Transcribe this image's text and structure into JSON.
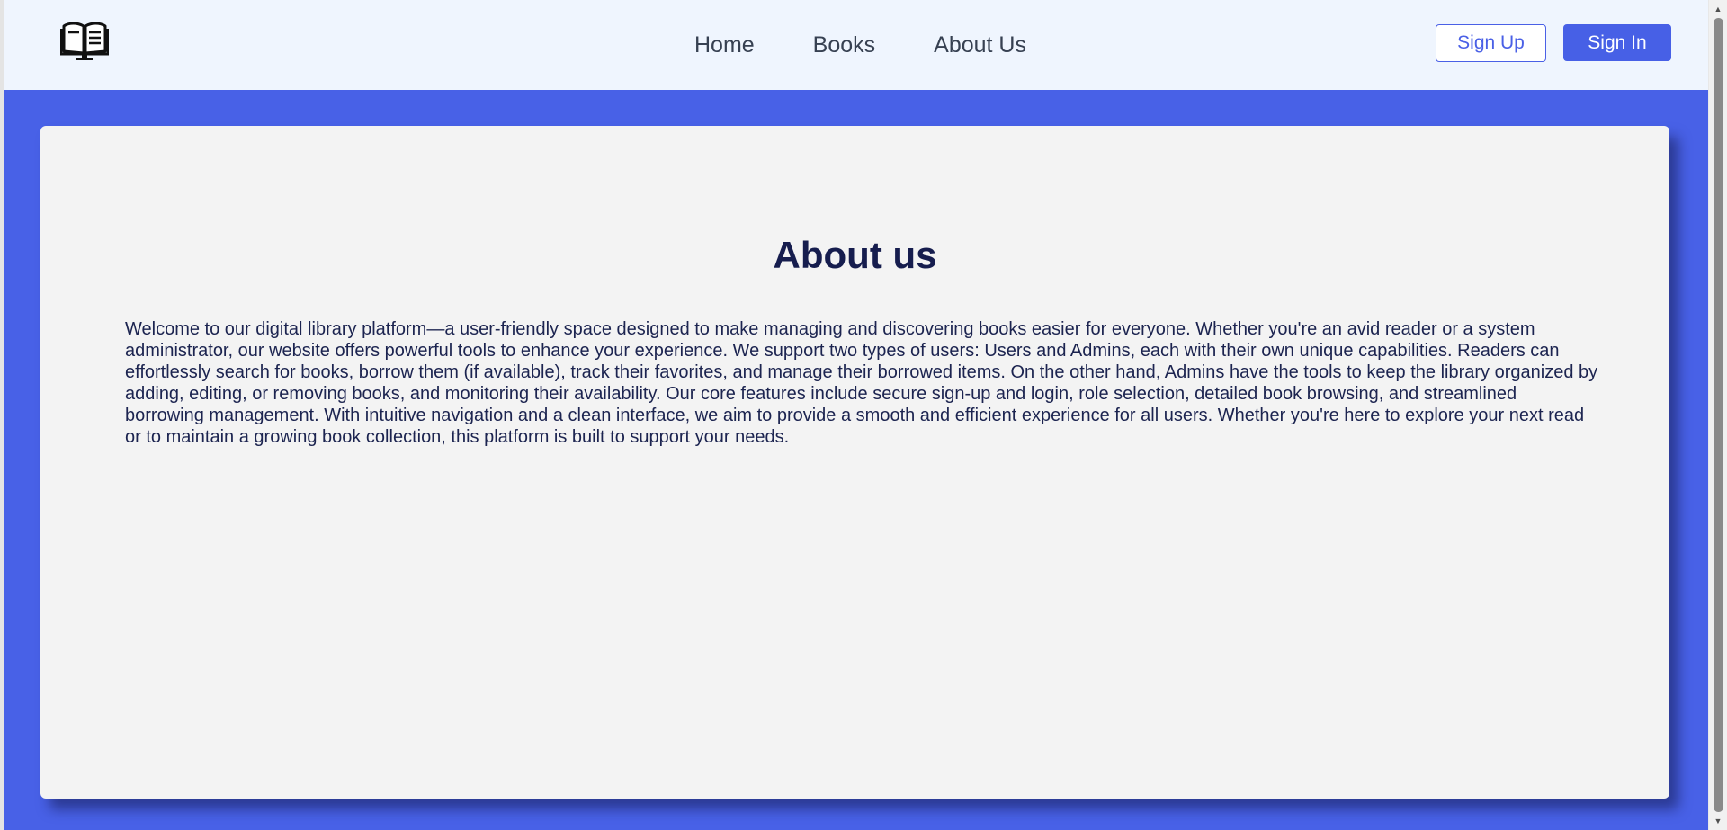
{
  "navbar": {
    "logo_icon": "open-book-monitor-icon",
    "links": [
      {
        "label": "Home"
      },
      {
        "label": "Books"
      },
      {
        "label": "About Us"
      }
    ],
    "signup_label": "Sign Up",
    "signin_label": "Sign In"
  },
  "about": {
    "title": "About us",
    "body": "Welcome to our digital library platform—a user-friendly space designed to make managing and discovering books easier for everyone. Whether you're an avid reader or a system administrator, our website offers powerful tools to enhance your experience. We support two types of users: Users and Admins, each with their own unique capabilities. Readers can effortlessly search for books, borrow them (if available), track their favorites, and manage their borrowed items. On the other hand, Admins have the tools to keep the library organized by adding, editing, or removing books, and monitoring their availability. Our core features include secure sign-up and login, role selection, detailed book browsing, and streamlined borrowing management. With intuitive navigation and a clean interface, we aim to provide a smooth and efficient experience for all users. Whether you're here to explore your next read or to maintain a growing book collection, this platform is built to support your needs."
  },
  "colors": {
    "accent": "#4861e7",
    "navbar_bg": "#eff5fe",
    "card_bg": "#f3f3f3",
    "title_color": "#161d4e"
  }
}
